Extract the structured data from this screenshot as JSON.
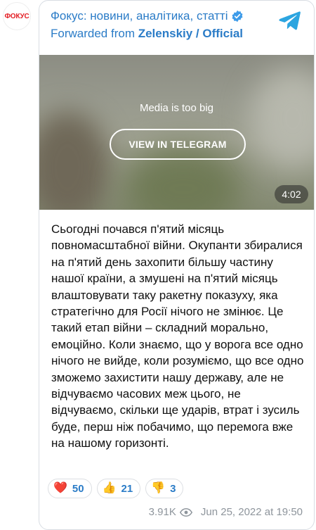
{
  "avatar": {
    "text": "ФОКУС"
  },
  "post": {
    "channel_name": "Фокус: новини, аналітика, статті",
    "forwarded_prefix": "Forwarded from",
    "forwarded_source": "Zelenskiy / Official",
    "media": {
      "notice": "Media is too big",
      "button_label": "VIEW IN TELEGRAM",
      "duration": "4:02"
    },
    "body": "Сьогодні почався п'ятий місяць повномасштабної війни. Окупанти збиралися на п'ятий день захопити більшу частину нашої країни, а змушені на п'ятий місяць влаштовувати таку ракетну показуху, яка стратегічно для Росії нічого не змінює. Це такий етап війни – складний морально, емоційно. Коли знаємо, що у ворога все одно нічого не вийде, коли розуміємо, що все одно зможемо захистити нашу державу, але не відчуваємо часових меж цього, не відчуваємо, скільки ще ударів, втрат і зусиль буде, перш ніж побачимо, що перемога вже на нашому горизонті.",
    "reactions": [
      {
        "icon": "heart-icon",
        "emoji": "❤️",
        "count": "50"
      },
      {
        "icon": "thumbs-up-icon",
        "emoji": "👍",
        "count": "21"
      },
      {
        "icon": "thumbs-down-icon",
        "emoji": "👎",
        "count": "3"
      }
    ],
    "views": "3.91K",
    "timestamp": "Jun 25, 2022 at 19:50"
  },
  "colors": {
    "link": "#2b7cc7",
    "meta": "#8e959c",
    "brand_red": "#e31e24",
    "telegram": "#2ca5e0"
  }
}
